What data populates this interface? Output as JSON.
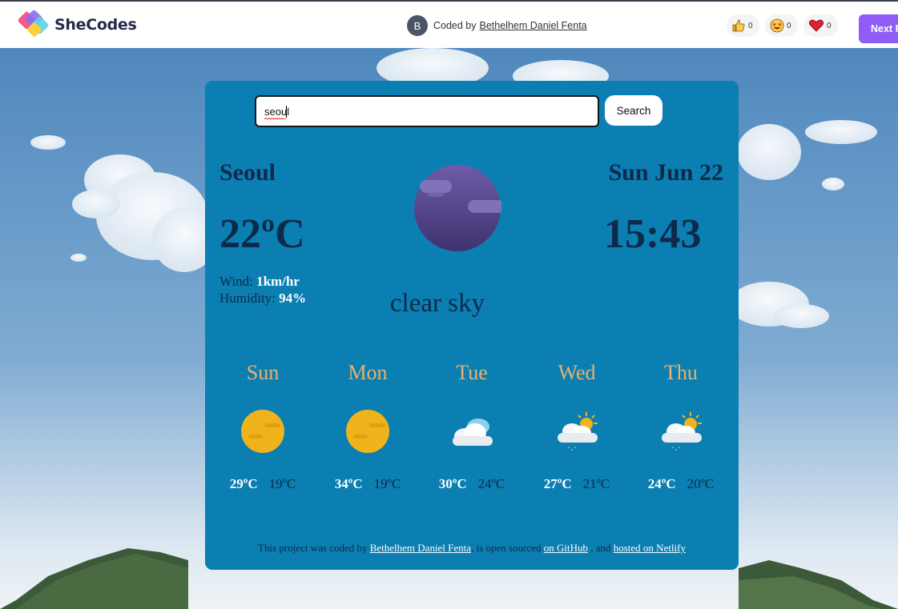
{
  "header": {
    "brand": "SheCodes",
    "avatar_initial": "B",
    "credit_prefix": "Coded by",
    "credit_author": "Bethelhem Daniel Fenta",
    "reactions": [
      {
        "icon": "thumbs-up-icon",
        "count": "0"
      },
      {
        "icon": "star-struck-icon",
        "count": "0"
      },
      {
        "icon": "heart-icon",
        "count": "0"
      }
    ],
    "next_button": "Next P"
  },
  "search": {
    "value": "seoul",
    "button": "Search"
  },
  "current": {
    "city": "Seoul",
    "temperature": "22ºC",
    "wind_label": "Wind:",
    "wind_value": "1km/hr",
    "humidity_label": "Humidity:",
    "humidity_value": "94%",
    "date": "Sun Jun 22",
    "time": "15:43",
    "description": "clear sky",
    "icon": "clear-night-moon-icon"
  },
  "forecast": [
    {
      "day": "Sun",
      "max": "29ºC",
      "min": "19ºC",
      "icon": "sun-icon"
    },
    {
      "day": "Mon",
      "max": "34ºC",
      "min": "19ºC",
      "icon": "sun-icon"
    },
    {
      "day": "Tue",
      "max": "30ºC",
      "min": "24ºC",
      "icon": "cloud-icon"
    },
    {
      "day": "Wed",
      "max": "27ºC",
      "min": "21ºC",
      "icon": "sun-cloud-rain-icon"
    },
    {
      "day": "Thu",
      "max": "24ºC",
      "min": "20ºC",
      "icon": "sun-cloud-rain-icon"
    }
  ],
  "footer": {
    "text1": "This project was coded by",
    "author": "Bethelhem Daniel Fenta",
    "text2": ", is open sourced",
    "github": "on GitHub",
    "text3": ", and",
    "netlify": "hosted on Netlify"
  },
  "colors": {
    "card": "#0b7fb2",
    "text_dark": "#0d2a4a",
    "day_name": "#e8b36e",
    "next_button": "#8f5cf7"
  }
}
